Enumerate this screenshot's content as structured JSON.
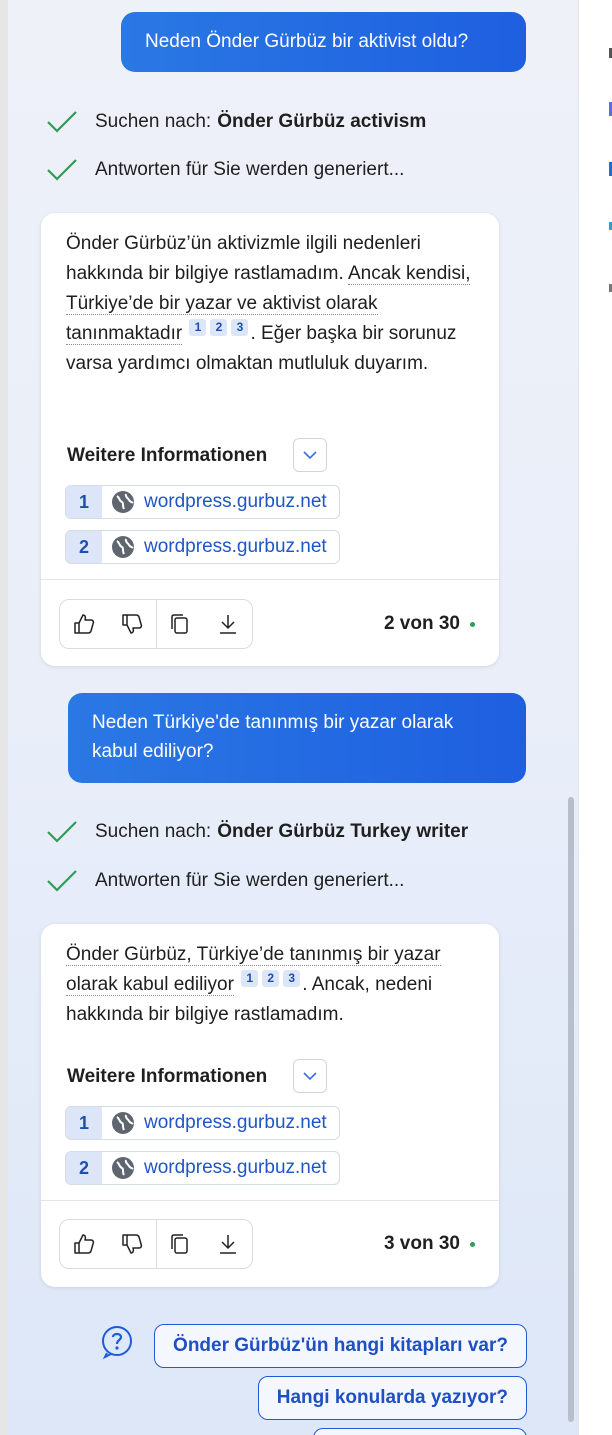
{
  "messages": {
    "user1": "Neden Önder Gürbüz bir aktivist oldu?",
    "status1": {
      "prefix": "Suchen nach:",
      "query": "Önder Gürbüz activism"
    },
    "status2": "Antworten für Sie werden generiert...",
    "answer1": {
      "part1": "Önder Gürbüz’ün aktivizmle ilgili nedenleri hakkında bir bilgiye rastlamadım. ",
      "part2_dotted": "Ancak kendisi, Türkiye’de bir yazar ve aktivist olarak tanınmaktadır",
      "part3": ". Eğer başka bir sorunuz varsa yardımcı olmaktan mutluluk duyarım.",
      "cites": [
        "1",
        "2",
        "3"
      ]
    },
    "more_label": "Weitere Informationen",
    "sources1": [
      {
        "num": "1",
        "url": "wordpress.gurbuz.net"
      },
      {
        "num": "2",
        "url": "wordpress.gurbuz.net"
      }
    ],
    "count1": "2 von 30",
    "user2": "Neden Türkiye'de tanınmış bir yazar olarak kabul ediliyor?",
    "status3": {
      "prefix": "Suchen nach:",
      "query": "Önder Gürbüz Turkey writer"
    },
    "status4": "Antworten für Sie werden generiert...",
    "answer2": {
      "part1_dotted": "Önder Gürbüz, Türkiye’de tanınmış bir yazar olarak kabul ediliyor",
      "part2": ". Ancak, nedeni hakkında bir bilgiye rastlamadım.",
      "cites": [
        "1",
        "2",
        "3"
      ]
    },
    "sources2": [
      {
        "num": "1",
        "url": "wordpress.gurbuz.net"
      },
      {
        "num": "2",
        "url": "wordpress.gurbuz.net"
      }
    ],
    "count2": "3 von 30"
  },
  "suggestions": [
    "Önder Gürbüz'ün hangi kitapları var?",
    "Hangi konularda yazıyor?"
  ],
  "colors": {
    "accent": "#1f5bd6",
    "user_bubble": "#2a78e4",
    "check": "#2f9e55",
    "link": "#1f56c6"
  },
  "icons": [
    "check-icon",
    "globe-icon",
    "chevron-down-icon",
    "thumbs-up-icon",
    "thumbs-down-icon",
    "copy-icon",
    "download-icon",
    "help-icon"
  ]
}
